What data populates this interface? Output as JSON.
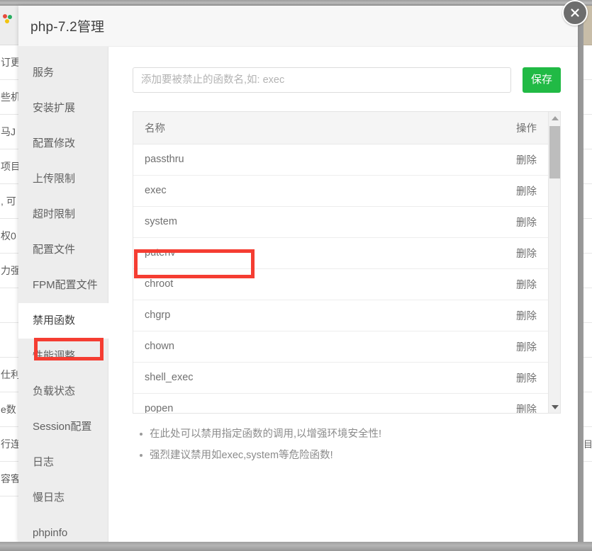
{
  "dialog": {
    "title": "php-7.2管理",
    "close_icon": "close-icon",
    "close_glyph": "✕"
  },
  "sidebar": {
    "items": [
      {
        "label": "服务",
        "active": false
      },
      {
        "label": "安装扩展",
        "active": false
      },
      {
        "label": "配置修改",
        "active": false
      },
      {
        "label": "上传限制",
        "active": false
      },
      {
        "label": "超时限制",
        "active": false
      },
      {
        "label": "配置文件",
        "active": false
      },
      {
        "label": "FPM配置文件",
        "active": false
      },
      {
        "label": "禁用函数",
        "active": true
      },
      {
        "label": "性能调整",
        "active": false
      },
      {
        "label": "负载状态",
        "active": false
      },
      {
        "label": "Session配置",
        "active": false
      },
      {
        "label": "日志",
        "active": false
      },
      {
        "label": "慢日志",
        "active": false
      },
      {
        "label": "phpinfo",
        "active": false
      }
    ]
  },
  "form": {
    "input_placeholder": "添加要被禁止的函数名,如: exec",
    "input_value": "",
    "save_label": "保存"
  },
  "table": {
    "headers": {
      "name": "名称",
      "operation": "操作"
    },
    "delete_label": "删除",
    "rows": [
      {
        "name": "passthru"
      },
      {
        "name": "exec"
      },
      {
        "name": "system"
      },
      {
        "name": "putenv"
      },
      {
        "name": "chroot"
      },
      {
        "name": "chgrp"
      },
      {
        "name": "chown"
      },
      {
        "name": "shell_exec"
      },
      {
        "name": "popen"
      }
    ]
  },
  "scrollbar": {
    "up_icon": "chevron-up-icon",
    "down_icon": "chevron-down-icon"
  },
  "notes": [
    "在此处可以禁用指定函数的调用,以增强环境安全性!",
    "强烈建议禁用如exec,system等危险函数!"
  ],
  "annotations": {
    "color": "#f53d32",
    "highlights": [
      "sidebar-item-disabled-functions",
      "table-row-system"
    ]
  },
  "background": {
    "left_fragments": [
      "",
      "订更",
      "些机",
      "马J",
      "项目",
      ", 可",
      "权0",
      "力强",
      "",
      "",
      "仕利",
      "e数",
      "行连",
      "容客"
    ],
    "right_fragments": [
      "",
      "",
      "",
      "",
      "",
      "",
      "",
      "",
      "",
      "",
      "",
      "",
      "",
      "目"
    ]
  }
}
